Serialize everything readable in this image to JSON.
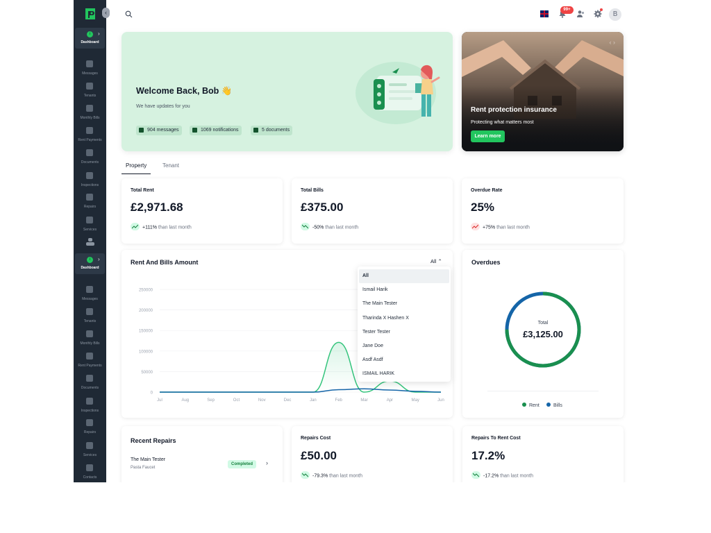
{
  "sidebar": {
    "groups": [
      {
        "dashboard_label": "Dashboard",
        "items": [
          {
            "label": "Messages",
            "icon": "messages-icon"
          },
          {
            "label": "Tenants",
            "icon": "tenants-icon"
          },
          {
            "label": "Monthly Bills",
            "icon": "bills-icon"
          },
          {
            "label": "Rent Payments",
            "icon": "payments-icon"
          },
          {
            "label": "Documents",
            "icon": "documents-icon"
          },
          {
            "label": "Inspections",
            "icon": "inspections-icon"
          },
          {
            "label": "Repairs",
            "icon": "repairs-icon"
          },
          {
            "label": "Services",
            "icon": "services-icon"
          }
        ]
      },
      {
        "dashboard_label": "Dashboard",
        "items": [
          {
            "label": "Messages",
            "icon": "messages-icon"
          },
          {
            "label": "Tenants",
            "icon": "tenants-icon"
          },
          {
            "label": "Monthly Bills",
            "icon": "bills-icon"
          },
          {
            "label": "Rent Payments",
            "icon": "payments-icon"
          },
          {
            "label": "Documents",
            "icon": "documents-icon"
          },
          {
            "label": "Inspections",
            "icon": "inspections-icon"
          },
          {
            "label": "Repairs",
            "icon": "repairs-icon"
          },
          {
            "label": "Services",
            "icon": "services-icon"
          },
          {
            "label": "Contacts",
            "icon": "contacts-icon"
          }
        ]
      }
    ]
  },
  "topbar": {
    "notification_badge": "99+",
    "avatar_initial": "B",
    "language_flag": "uk-flag"
  },
  "welcome": {
    "title": "Welcome Back, Bob 👋",
    "subtitle": "We have updates for you",
    "chips": [
      {
        "count": "904",
        "label": "messages",
        "icon": "message-icon"
      },
      {
        "count": "1069",
        "label": "notifications",
        "icon": "bell-icon"
      },
      {
        "count": "5",
        "label": "documents",
        "icon": "document-icon"
      }
    ]
  },
  "promo": {
    "title": "Rent protection insurance",
    "subtitle": "Protecting what matters most",
    "button": "Learn more"
  },
  "tabs": [
    "Property",
    "Tenant"
  ],
  "stats": [
    {
      "label": "Total Rent",
      "value": "£2,971.68",
      "change": "+111%",
      "suffix": "than last month",
      "direction": "up"
    },
    {
      "label": "Total Bills",
      "value": "£375.00",
      "change": "-50%",
      "suffix": "than last month",
      "direction": "down"
    },
    {
      "label": "Overdue Rate",
      "value": "25%",
      "change": "+75%",
      "suffix": "than last month",
      "direction": "up-bad"
    }
  ],
  "rent_chart": {
    "title": "Rent And Bills Amount",
    "filter": "All",
    "dropdown_options": [
      "All",
      "Ismail Harik",
      "The Main Tester",
      "Tharinda X Hashen X",
      "Tester Tester",
      "Jane Doe",
      "Asdf Asdf",
      "ISMAIL HARIK"
    ],
    "selected_option": "All"
  },
  "chart_data": {
    "type": "line",
    "title": "Rent And Bills Amount",
    "categories": [
      "Jul",
      "Aug",
      "Sep",
      "Oct",
      "Nov",
      "Dec",
      "Jan",
      "Feb",
      "Mar",
      "Apr",
      "May",
      "Jun"
    ],
    "yticks": [
      "250000",
      "200000",
      "150000",
      "100000",
      "50000",
      "0"
    ],
    "ylim": [
      0,
      250000
    ],
    "grid": true,
    "series": [
      {
        "name": "Rent",
        "color": "#34c47c",
        "values": [
          0,
          0,
          0,
          0,
          0,
          0,
          0,
          121000,
          0,
          27000,
          0,
          0
        ]
      },
      {
        "name": "Bills",
        "color": "#1565a8",
        "values": [
          0,
          0,
          0,
          0,
          0,
          0,
          0,
          6000,
          8000,
          5000,
          2000,
          0
        ]
      }
    ]
  },
  "overdues": {
    "title": "Overdues",
    "total_label": "Total",
    "total_value": "£3,125.00",
    "legend": [
      {
        "name": "Rent",
        "color": "#1a8f4f"
      },
      {
        "name": "Bills",
        "color": "#1565a8"
      }
    ],
    "rent_share": 0.75
  },
  "repairs": {
    "title": "Recent Repairs",
    "items": [
      {
        "name": "The Main Tester",
        "item": "Pasta Faucet",
        "status": "Completed"
      }
    ]
  },
  "repair_stats": [
    {
      "label": "Repairs Cost",
      "value": "£50.00",
      "change": "-79.3%",
      "suffix": "than last month"
    },
    {
      "label": "Repairs To Rent Cost",
      "value": "17.2%",
      "change": "-17.2%",
      "suffix": "than last month"
    }
  ]
}
